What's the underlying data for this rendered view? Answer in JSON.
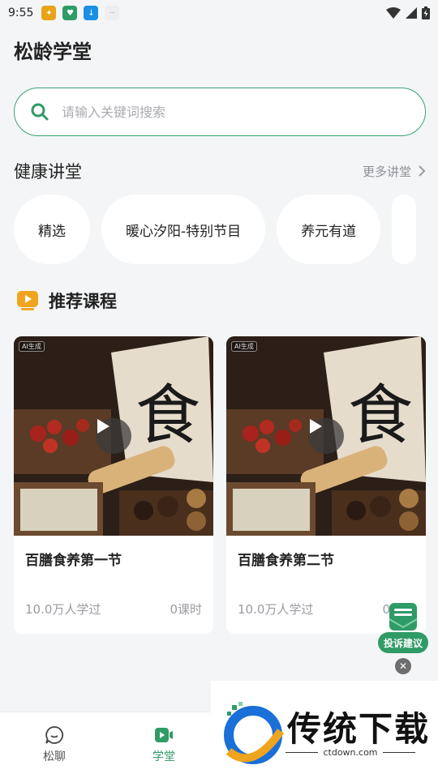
{
  "status_bar": {
    "time": "9:55"
  },
  "app": {
    "title": "松龄学堂"
  },
  "search": {
    "placeholder": "请输入关键词搜索"
  },
  "health_section": {
    "title": "健康讲堂",
    "more_label": "更多讲堂",
    "chips": [
      {
        "label": "精选"
      },
      {
        "label": "暖心汐阳-特别节目"
      },
      {
        "label": "养元有道"
      }
    ]
  },
  "recommend": {
    "title": "推荐课程",
    "courses": [
      {
        "name": "百膳食养第一节",
        "learners": "10.0万人学过",
        "lessons": "0课时",
        "tag": "AI生成",
        "thumb_char": "食"
      },
      {
        "name": "百膳食养第二节",
        "learners": "10.0万人学过",
        "lessons": "0课时",
        "tag": "AI生成",
        "thumb_char": "食"
      }
    ]
  },
  "feedback": {
    "label": "投诉建议",
    "close_symbol": "✕"
  },
  "tabs": [
    {
      "label": "松聊",
      "icon": "chat-bubble-icon",
      "active": false
    },
    {
      "label": "学堂",
      "icon": "video-play-icon",
      "active": true
    }
  ],
  "watermark": {
    "title": "传统下载",
    "url": "ctdown.com"
  },
  "colors": {
    "accent": "#2f9b66",
    "background": "#f4f5f7",
    "muted_text": "#9a9ca1",
    "rec_icon": "#f0a41d"
  }
}
